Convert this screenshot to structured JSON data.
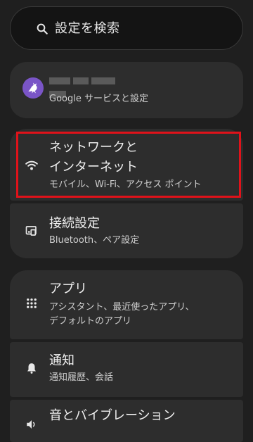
{
  "search": {
    "placeholder": "設定を検索",
    "icon": "search-icon"
  },
  "account": {
    "subtitle": "Google サービスと設定",
    "avatar_icon": "bird-avatar-icon",
    "avatar_color": "#7a55c7"
  },
  "items": [
    {
      "title_line1": "ネットワークと",
      "title_line2": "インターネット",
      "subtitle": "モバイル、Wi-Fi、アクセス ポイント",
      "icon": "wifi-icon"
    },
    {
      "title": "接続設定",
      "subtitle": "Bluetooth、ペア設定",
      "icon": "connected-devices-icon"
    },
    {
      "title": "アプリ",
      "subtitle_line1": "アシスタント、最近使ったアプリ、",
      "subtitle_line2": "デフォルトのアプリ",
      "icon": "apps-grid-icon"
    },
    {
      "title": "通知",
      "subtitle": "通知履歴、会話",
      "icon": "bell-icon"
    },
    {
      "title": "音とバイブレーション",
      "icon": "volume-icon"
    }
  ],
  "colors": {
    "background": "#1f1f1f",
    "card": "#2d2d2d",
    "highlight": "#e0121a"
  }
}
